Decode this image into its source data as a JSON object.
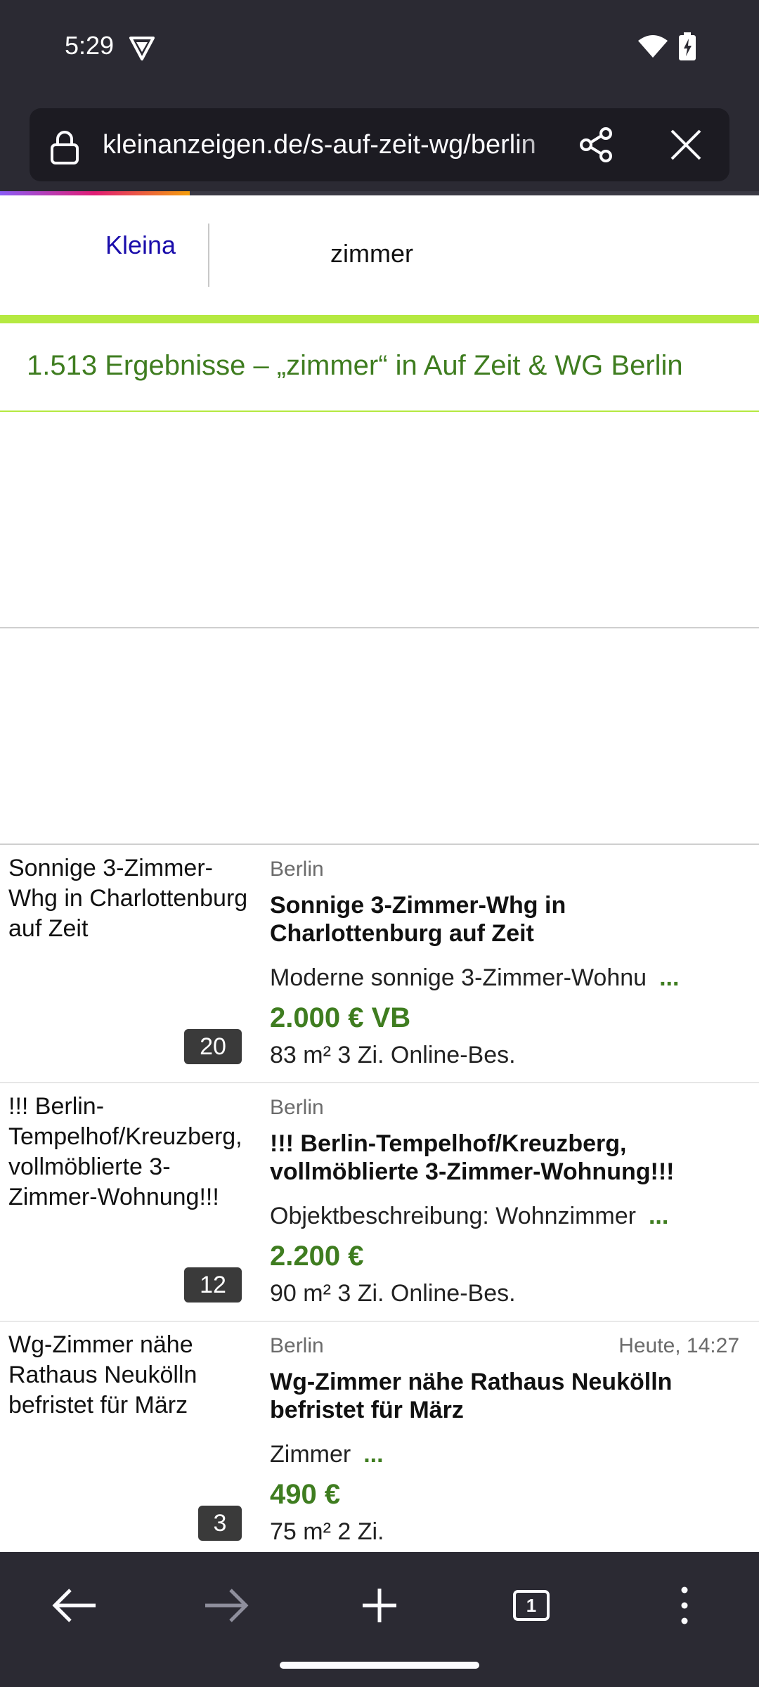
{
  "status_bar": {
    "time": "5:29"
  },
  "browser": {
    "url": "kleinanzeigen.de/s-auf-zeit-wg/berlin",
    "page_load_progress": 0.25
  },
  "site": {
    "brand_link": "Kleina",
    "search_query": "zimmer",
    "results_heading": "1.513 Ergebnisse – „zimmer“ in Auf Zeit & WG Berlin"
  },
  "listings": [
    {
      "thumb_alt": "Sonnige 3-Zimmer-Whg in Charlottenburg auf Zeit",
      "photo_count": "20",
      "location": "Berlin",
      "time": "",
      "title": "Sonnige 3-Zimmer-Whg in Charlottenburg auf Zeit",
      "description": "Moderne sonnige 3-Zimmer-Wohnu",
      "more": "...",
      "price": "2.000 € VB",
      "specs": "83 m² 3 Zi. Online-Bes."
    },
    {
      "thumb_alt": "!!! Berlin-Tempelhof/Kreuzberg, vollmöblierte 3-Zimmer-Wohnung!!!",
      "photo_count": "12",
      "location": "Berlin",
      "time": "",
      "title": "!!! Berlin-Tempelhof/Kreuzberg, vollmöblierte 3-Zimmer-Wohnung!!!",
      "description": "Objektbeschreibung: Wohnzimmer",
      "more": "...",
      "price": "2.200 €",
      "specs": "90 m² 3 Zi. Online-Bes."
    },
    {
      "thumb_alt": "Wg-Zimmer nähe Rathaus Neukölln befristet für März",
      "photo_count": "3",
      "location": "Berlin",
      "time": "Heute, 14:27",
      "title": "Wg-Zimmer nähe Rathaus Neukölln befristet für März",
      "description": "Zimmer",
      "more": "...",
      "price": "490 €",
      "specs": "75 m² 2 Zi."
    }
  ],
  "icons": {
    "vpn": "vpn-shield-icon",
    "wifi": "wifi-icon",
    "battery": "battery-charging-icon",
    "lock": "lock-icon",
    "share": "share-icon",
    "close": "close-icon",
    "back": "back-arrow-icon",
    "forward": "forward-arrow-icon",
    "new_tab": "plus-icon",
    "tabs": "tab-counter-icon",
    "menu": "more-vert-icon"
  },
  "nav": {
    "tab_count": "1"
  },
  "colors": {
    "chrome": "#2b2a33",
    "url_box": "#1c1b22",
    "accent_green": "#3f7d20",
    "site_green_bar": "#b5e941",
    "brand_link": "#1a0dab"
  }
}
